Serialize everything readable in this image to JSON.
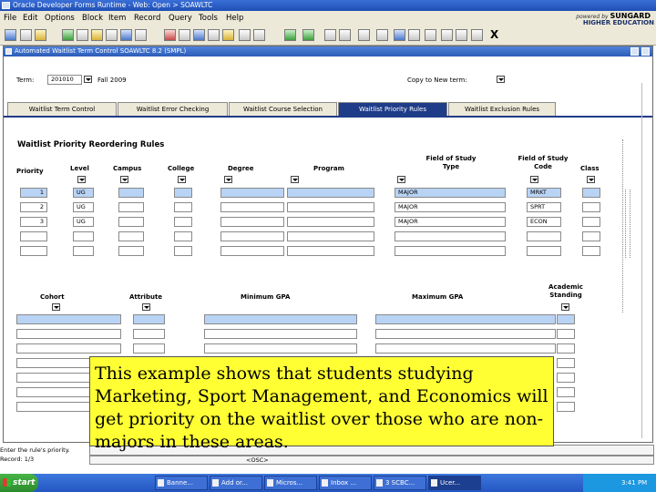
{
  "window": {
    "title": "Oracle Developer Forms Runtime - Web: Open > SOAWLTC"
  },
  "menu": {
    "items": [
      "File",
      "Edit",
      "Options",
      "Block",
      "Item",
      "Record",
      "Query",
      "Tools",
      "Help"
    ]
  },
  "brand": {
    "powered_by": "powered by",
    "name": "SUNGARD",
    "sub": "HIGHER EDUCATION"
  },
  "toolbar": {
    "close_label": "X"
  },
  "form": {
    "title": "Automated Waitlist Term Control SOAWLTC 8.2 (SMPL)",
    "term_label": "Term:",
    "term_value": "201010",
    "term_desc": "Fall 2009",
    "copy_label": "Copy to New term:"
  },
  "tabs": [
    {
      "label": "Waitlist Term Control",
      "active": false
    },
    {
      "label": "Waitlist Error Checking",
      "active": false
    },
    {
      "label": "Waitlist Course Selection",
      "active": false
    },
    {
      "label": "Waitlist Priority Rules",
      "active": true
    },
    {
      "label": "Waitlist Exclusion Rules",
      "active": false
    }
  ],
  "section": {
    "title": "Waitlist Priority Reordering Rules",
    "headers": {
      "priority": "Priority",
      "level": "Level",
      "campus": "Campus",
      "college": "College",
      "degree": "Degree",
      "program": "Program",
      "fos_type_1": "Field of Study",
      "fos_type_2": "Type",
      "fos_code_1": "Field of Study",
      "fos_code_2": "Code",
      "class": "Class"
    },
    "rows": [
      {
        "priority": "1",
        "level": "UG",
        "fos_type": "MAJOR",
        "fos_code": "MRKT"
      },
      {
        "priority": "2",
        "level": "UG",
        "fos_type": "MAJOR",
        "fos_code": "SPRT"
      },
      {
        "priority": "3",
        "level": "UG",
        "fos_type": "MAJOR",
        "fos_code": "ECON"
      }
    ],
    "lower_headers": {
      "cohort": "Cohort",
      "attribute": "Attribute",
      "min_gpa": "Minimum GPA",
      "max_gpa": "Maximum GPA",
      "academic_1": "Academic",
      "academic_2": "Standing"
    }
  },
  "status": {
    "message": "Enter the rule's priority.",
    "record": "Record: 1/3",
    "osc": "<OSC>"
  },
  "callout": {
    "text": "This example shows that students studying Marketing, Sport Management, and Economics will get priority on the waitlist over those who are non-majors in these areas."
  },
  "taskbar": {
    "start": "start",
    "tasks": [
      "Banne...",
      "Add or...",
      "Micros...",
      "Inbox ...",
      "3 SCBC...",
      "Ucer..."
    ],
    "clock": "3:41 PM"
  },
  "colors": {
    "highlight_field": "#b9d3f5",
    "callout": "#ffff33",
    "tab_active": "#1f3c88",
    "taskbar": "#2556c3"
  }
}
